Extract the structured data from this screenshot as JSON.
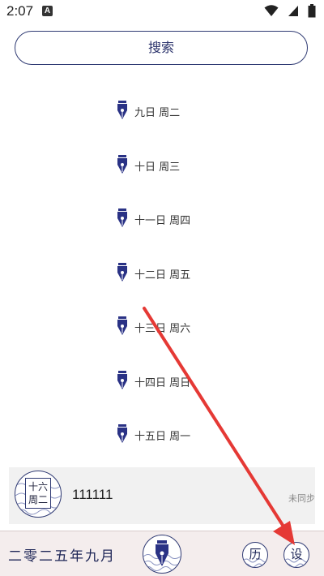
{
  "status_bar": {
    "time": "2:07",
    "notification_letter": "A",
    "icons": [
      "wifi-icon",
      "signal-icon",
      "battery-icon"
    ]
  },
  "search": {
    "label": "搜索"
  },
  "dates": [
    {
      "label": "九日 周二"
    },
    {
      "label": "十日 周三"
    },
    {
      "label": "十一日 周四"
    },
    {
      "label": "十二日 周五"
    },
    {
      "label": "十三日 周六"
    },
    {
      "label": "十四日 周日"
    },
    {
      "label": "十五日 周一"
    }
  ],
  "entry": {
    "badge_day": "十六",
    "badge_weekday": "周二",
    "title": "111111",
    "sync_status": "未同步"
  },
  "bottom_bar": {
    "month_label": "二零二五年九月",
    "history_label": "历",
    "settings_label": "设"
  },
  "colors": {
    "accent": "#2f3a73",
    "ink": "#1e2657",
    "annotation": "#e53935",
    "bottom_bar_bg": "#f4eded",
    "card_bg": "#f1f1f1"
  }
}
